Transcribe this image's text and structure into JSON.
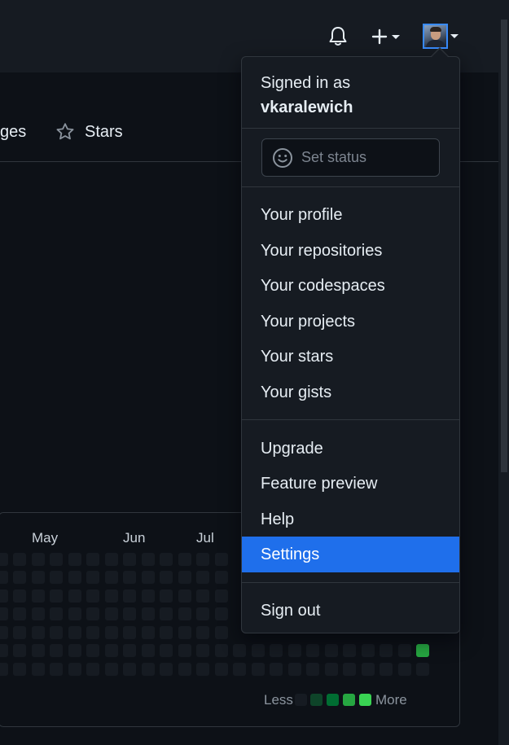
{
  "header": {
    "bell_icon": "bell-icon",
    "plus_icon": "plus-icon",
    "avatar_alt": "user avatar"
  },
  "tabs": {
    "partial_label": "ges",
    "stars_label": "Stars"
  },
  "user_menu": {
    "signed_in_as": "Signed in as",
    "username": "vkaralewich",
    "set_status_placeholder": "Set status",
    "group1": [
      "Your profile",
      "Your repositories",
      "Your codespaces",
      "Your projects",
      "Your stars",
      "Your gists"
    ],
    "group2": [
      "Upgrade",
      "Feature preview",
      "Help",
      "Settings"
    ],
    "active_item": "Settings",
    "sign_out": "Sign out"
  },
  "contributions": {
    "months": [
      "May",
      "Jun",
      "Jul"
    ],
    "legend_less": "Less",
    "legend_more": "More",
    "legend_colors": [
      "#161b22",
      "#0e4429",
      "#006d32",
      "#26a641",
      "#39d353"
    ],
    "highlight_color": "#26a641"
  },
  "colors": {
    "accent": "#1f6feb",
    "background": "#0d1117",
    "header": "#161b22"
  }
}
